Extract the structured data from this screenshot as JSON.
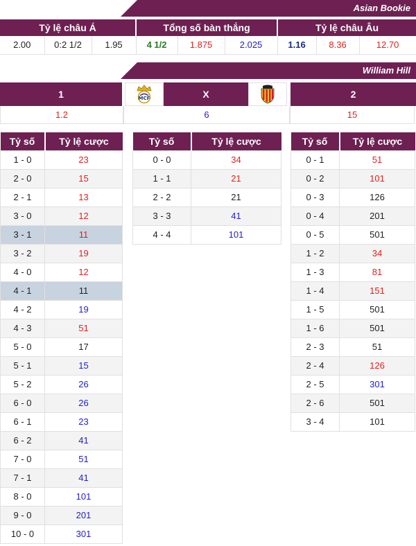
{
  "asian_bookie": {
    "banner": "Asian Bookie",
    "headers": [
      "Tỷ lệ châu Á",
      "Tổng số bàn thắng",
      "Tỷ lệ châu Âu"
    ],
    "values": [
      {
        "text": "2.00",
        "color": "black"
      },
      {
        "text": "0:2 1/2",
        "color": "black"
      },
      {
        "text": "1.95",
        "color": "black"
      },
      {
        "text": "4 1/2",
        "color": "green"
      },
      {
        "text": "1.875",
        "color": "red"
      },
      {
        "text": "2.025",
        "color": "blue"
      },
      {
        "text": "1.16",
        "color": "navy"
      },
      {
        "text": "8.36",
        "color": "red"
      },
      {
        "text": "12.70",
        "color": "red"
      }
    ]
  },
  "william_hill": {
    "banner": "William Hill",
    "home_label": "1",
    "draw_label": "X",
    "away_label": "2",
    "home_odds": "1.2",
    "draw_odds": "6",
    "away_odds": "15",
    "home_logo_icon": "real-madrid-crest-icon",
    "away_logo_icon": "valencia-crest-icon"
  },
  "score_headers": {
    "score": "Tỷ số",
    "odds": "Tỷ lệ cược"
  },
  "score_tables": {
    "home": [
      {
        "score": "1 - 0",
        "odds": "23",
        "color": "red"
      },
      {
        "score": "2 - 0",
        "odds": "15",
        "color": "red"
      },
      {
        "score": "2 - 1",
        "odds": "13",
        "color": "red"
      },
      {
        "score": "3 - 0",
        "odds": "12",
        "color": "red"
      },
      {
        "score": "3 - 1",
        "odds": "11",
        "color": "red",
        "highlight": true
      },
      {
        "score": "3 - 2",
        "odds": "19",
        "color": "red"
      },
      {
        "score": "4 - 0",
        "odds": "12",
        "color": "red"
      },
      {
        "score": "4 - 1",
        "odds": "11",
        "color": "black",
        "highlight": true
      },
      {
        "score": "4 - 2",
        "odds": "19",
        "color": "blue"
      },
      {
        "score": "4 - 3",
        "odds": "51",
        "color": "red"
      },
      {
        "score": "5 - 0",
        "odds": "17",
        "color": "black"
      },
      {
        "score": "5 - 1",
        "odds": "15",
        "color": "blue"
      },
      {
        "score": "5 - 2",
        "odds": "26",
        "color": "blue"
      },
      {
        "score": "6 - 0",
        "odds": "26",
        "color": "blue"
      },
      {
        "score": "6 - 1",
        "odds": "23",
        "color": "blue"
      },
      {
        "score": "6 - 2",
        "odds": "41",
        "color": "blue"
      },
      {
        "score": "7 - 0",
        "odds": "51",
        "color": "blue"
      },
      {
        "score": "7 - 1",
        "odds": "41",
        "color": "blue"
      },
      {
        "score": "8 - 0",
        "odds": "101",
        "color": "blue"
      },
      {
        "score": "9 - 0",
        "odds": "201",
        "color": "blue"
      },
      {
        "score": "10 - 0",
        "odds": "301",
        "color": "blue"
      }
    ],
    "draw": [
      {
        "score": "0 - 0",
        "odds": "34",
        "color": "red"
      },
      {
        "score": "1 - 1",
        "odds": "21",
        "color": "red"
      },
      {
        "score": "2 - 2",
        "odds": "21",
        "color": "black"
      },
      {
        "score": "3 - 3",
        "odds": "41",
        "color": "blue"
      },
      {
        "score": "4 - 4",
        "odds": "101",
        "color": "blue"
      }
    ],
    "away": [
      {
        "score": "0 - 1",
        "odds": "51",
        "color": "red"
      },
      {
        "score": "0 - 2",
        "odds": "101",
        "color": "red"
      },
      {
        "score": "0 - 3",
        "odds": "126",
        "color": "black"
      },
      {
        "score": "0 - 4",
        "odds": "201",
        "color": "black"
      },
      {
        "score": "0 - 5",
        "odds": "501",
        "color": "black"
      },
      {
        "score": "1 - 2",
        "odds": "34",
        "color": "red"
      },
      {
        "score": "1 - 3",
        "odds": "81",
        "color": "red"
      },
      {
        "score": "1 - 4",
        "odds": "151",
        "color": "red"
      },
      {
        "score": "1 - 5",
        "odds": "501",
        "color": "black"
      },
      {
        "score": "1 - 6",
        "odds": "501",
        "color": "black"
      },
      {
        "score": "2 - 3",
        "odds": "51",
        "color": "black"
      },
      {
        "score": "2 - 4",
        "odds": "126",
        "color": "red"
      },
      {
        "score": "2 - 5",
        "odds": "301",
        "color": "blue"
      },
      {
        "score": "2 - 6",
        "odds": "501",
        "color": "black"
      },
      {
        "score": "3 - 4",
        "odds": "101",
        "color": "black"
      }
    ]
  },
  "colors": {
    "header_bg": "#6e2052",
    "red": "#e02020",
    "blue": "#2020d0",
    "green": "#287a28",
    "navy": "#1a2a80",
    "highlight": "#c7d3df"
  }
}
